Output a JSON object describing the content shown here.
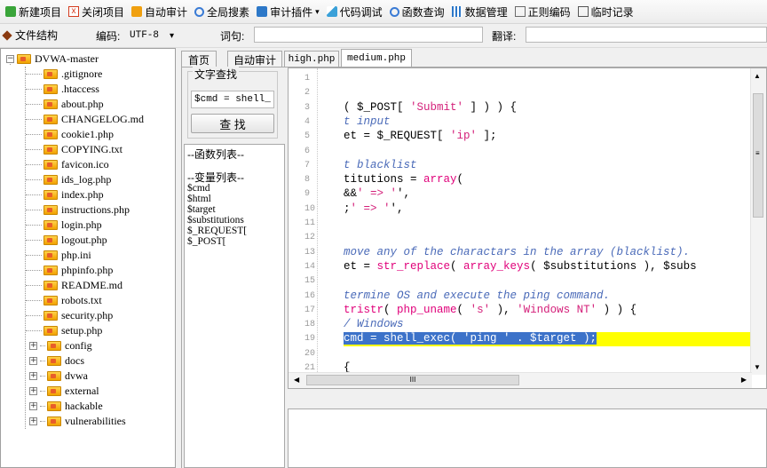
{
  "toolbar": {
    "items": [
      {
        "label": "新建项目",
        "icon": "new-project-icon",
        "color": "#3aa53a"
      },
      {
        "label": "关闭项目",
        "icon": "close-project-icon",
        "color": "#d43b1f"
      },
      {
        "label": "自动审计",
        "icon": "auto-audit-icon",
        "color": "#f0a010"
      },
      {
        "label": "全局搜素",
        "icon": "global-search-icon",
        "color": "#3a7bd5"
      },
      {
        "label": "审计插件",
        "icon": "audit-plugin-icon",
        "color": "#2d78c8"
      },
      {
        "label": "代码调试",
        "icon": "code-debug-icon",
        "color": "#3aa0d8"
      },
      {
        "label": "函数查询",
        "icon": "function-query-icon",
        "color": "#3a7bd5"
      },
      {
        "label": "数据管理",
        "icon": "data-manage-icon",
        "color": "#2b77c9"
      },
      {
        "label": "正则编码",
        "icon": "regex-encode-icon",
        "color": "#6a6a6a"
      },
      {
        "label": "临时记录",
        "icon": "temp-record-icon",
        "color": "#555555"
      }
    ],
    "dropdown_glyph": "▾"
  },
  "bar2": {
    "file_structure": "文件结构",
    "encoding_label": "编码:",
    "encoding_value": "UTF-8",
    "phrase_label": "词句:",
    "translate_label": "翻译:"
  },
  "tree": {
    "root": "DVWA-master",
    "files": [
      ".gitignore",
      ".htaccess",
      "about.php",
      "CHANGELOG.md",
      "cookie1.php",
      "COPYING.txt",
      "favicon.ico",
      "ids_log.php",
      "index.php",
      "instructions.php",
      "login.php",
      "logout.php",
      "php.ini",
      "phpinfo.php",
      "README.md",
      "robots.txt",
      "security.php",
      "setup.php"
    ],
    "folders": [
      "config",
      "docs",
      "dvwa",
      "external",
      "hackable",
      "vulnerabilities"
    ]
  },
  "tabs": [
    {
      "label": "首页",
      "active": false
    },
    {
      "label": "自动审计",
      "active": false
    },
    {
      "label": "high.php",
      "active": false
    },
    {
      "label": "medium.php",
      "active": true
    }
  ],
  "search_panel": {
    "title": "文字查找",
    "input_value": "$cmd = shell_",
    "find_button": "查 找",
    "func_list_header": "--函数列表--",
    "var_list_header": "--变量列表--",
    "variables": [
      "$cmd",
      "$html",
      "$target",
      "$substitutions",
      "$_REQUEST[",
      "$_POST["
    ]
  },
  "editor": {
    "line_numbers": [
      "1",
      "2",
      "3",
      "4",
      "5",
      "6",
      "7",
      "8",
      "9",
      "10",
      "11",
      "12",
      "13",
      "14",
      "15",
      "16",
      "17",
      "18",
      "19",
      "20",
      "21"
    ],
    "lines": [
      {
        "n": "1",
        "text": ""
      },
      {
        "n": "2",
        "text": ""
      },
      {
        "n": "3",
        "text": "( $_POST[ 'Submit' ] ) ) {"
      },
      {
        "n": "4",
        "text": "t input"
      },
      {
        "n": "5",
        "text": "et = $_REQUEST[ 'ip' ];"
      },
      {
        "n": "6",
        "text": ""
      },
      {
        "n": "7",
        "text": "t blacklist"
      },
      {
        "n": "8",
        "text": "titutions = array("
      },
      {
        "n": "9",
        "text": "&&' => '',"
      },
      {
        "n": "10",
        "text": ";' => '',"
      },
      {
        "n": "11",
        "text": ""
      },
      {
        "n": "12",
        "text": ""
      },
      {
        "n": "13",
        "text": "move any of the charactars in the array (blacklist)."
      },
      {
        "n": "14",
        "text": "et = str_replace( array_keys( $substitutions ), $subs"
      },
      {
        "n": "15",
        "text": ""
      },
      {
        "n": "16",
        "text": "termine OS and execute the ping command."
      },
      {
        "n": "17",
        "text": "tristr( php_uname( 's' ), 'Windows NT' ) ) {"
      },
      {
        "n": "18",
        "text": "/ Windows"
      },
      {
        "n": "19",
        "text": "cmd = shell_exec( 'ping ' . $target );"
      },
      {
        "n": "20",
        "text": ""
      },
      {
        "n": "21",
        "text": "{"
      }
    ],
    "highlight_color": "#ffff00",
    "selection_color": "#3c72c9",
    "hscroll_thumb_label": "III"
  }
}
